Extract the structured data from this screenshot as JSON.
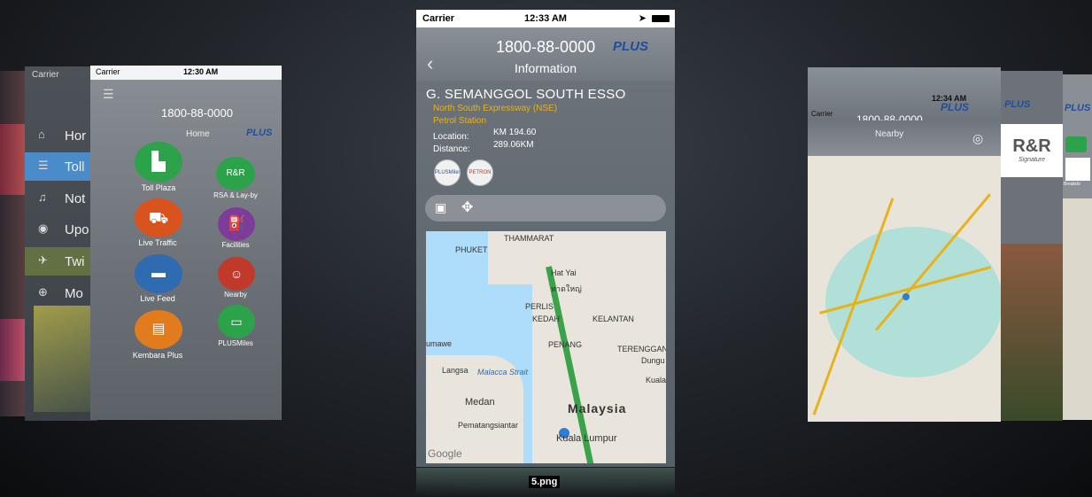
{
  "center": {
    "status": {
      "carrier": "Carrier",
      "time": "12:33 AM"
    },
    "header": {
      "phone": "1800-88-0000",
      "logo": "PLUS",
      "title": "Information"
    },
    "station": {
      "name": "G. SEMANGGOL SOUTH ESSO",
      "expressway": "North South Expressway (NSE)",
      "type": "Petrol Station",
      "location_label": "Location:",
      "location_value": "KM 194.60",
      "distance_label": "Distance:",
      "distance_value": "289.06KM"
    },
    "badges": [
      "PLUSMiles RELOAD",
      "PETRON"
    ],
    "toolbar": {
      "icons": [
        "image-icon",
        "directions-icon"
      ]
    },
    "map": {
      "labels": [
        "THAMMARAT",
        "PHUKET",
        "Hat Yai",
        "หาดใหญ่",
        "PERLIS",
        "KEDAH",
        "KELANTAN",
        "PENANG",
        "umawe",
        "Langsa",
        "Malacca Strait",
        "TERENGGAN",
        "Dungu",
        "Kuala",
        "Medan",
        "Malaysia",
        "Pematangsiantar",
        "Kuala Lumpur",
        "Google"
      ]
    }
  },
  "left_menu": {
    "items": [
      "Hor",
      "Toll",
      "Not",
      "Upo",
      "Twi",
      "Mo"
    ]
  },
  "home_panel": {
    "status": {
      "carrier": "Carrier",
      "time": "12:30 AM"
    },
    "phone": "1800-88-0000",
    "title": "Home",
    "logo": "PLUS",
    "tiles": [
      {
        "label": "Toll Plaza"
      },
      {
        "label": "RSA & Lay-by"
      },
      {
        "label": "Live Traffic"
      },
      {
        "label": "Facilities"
      },
      {
        "label": "Live Feed"
      },
      {
        "label": "Nearby"
      },
      {
        "label": "Kembara Plus"
      },
      {
        "label": "PLUSMiles"
      }
    ]
  },
  "nearby_panel": {
    "status": {
      "carrier": "Carrier",
      "time": "12:34 AM"
    },
    "phone": "1800-88-0000",
    "title": "Nearby",
    "logo": "PLUS"
  },
  "right_panel2": {
    "logo": "PLUS",
    "sign": "R&R",
    "sub": "Signature"
  },
  "right_panel3": {
    "logo": "PLUS",
    "sub": "Breakdo"
  },
  "caption": "5.png",
  "colors": {
    "accent_green": "#2ca34a",
    "accent_red": "#c0392b",
    "accent_blue": "#2e6bb0",
    "accent_orange": "#e07b1e",
    "accent_purple": "#7d3c98",
    "plus_blue": "#1d4f9e",
    "highway_yellow": "#e8b21a"
  }
}
